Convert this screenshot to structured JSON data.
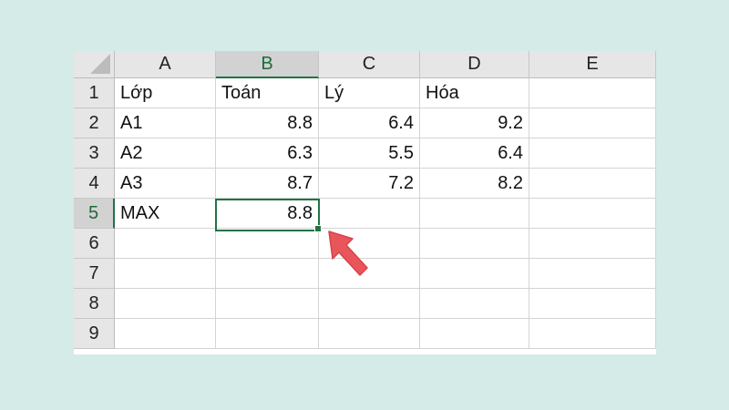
{
  "columns": [
    "A",
    "B",
    "C",
    "D",
    "E"
  ],
  "rows": [
    "1",
    "2",
    "3",
    "4",
    "5",
    "6",
    "7",
    "8",
    "9"
  ],
  "cells": {
    "A1": "Lớp",
    "B1": "Toán",
    "C1": "Lý",
    "D1": "Hóa",
    "A2": "A1",
    "B2": "8.8",
    "C2": "6.4",
    "D2": "9.2",
    "A3": "A2",
    "B3": "6.3",
    "C3": "5.5",
    "D3": "6.4",
    "A4": "A3",
    "B4": "8.7",
    "C4": "7.2",
    "D4": "8.2",
    "A5": "MAX",
    "B5": "8.8"
  },
  "active_cell": "B5",
  "colors": {
    "background": "#d4ebe8",
    "selection": "#217346",
    "arrow": "#e8565c"
  },
  "icons": {
    "pointer": "red-arrow-icon",
    "corner": "select-all-icon"
  }
}
